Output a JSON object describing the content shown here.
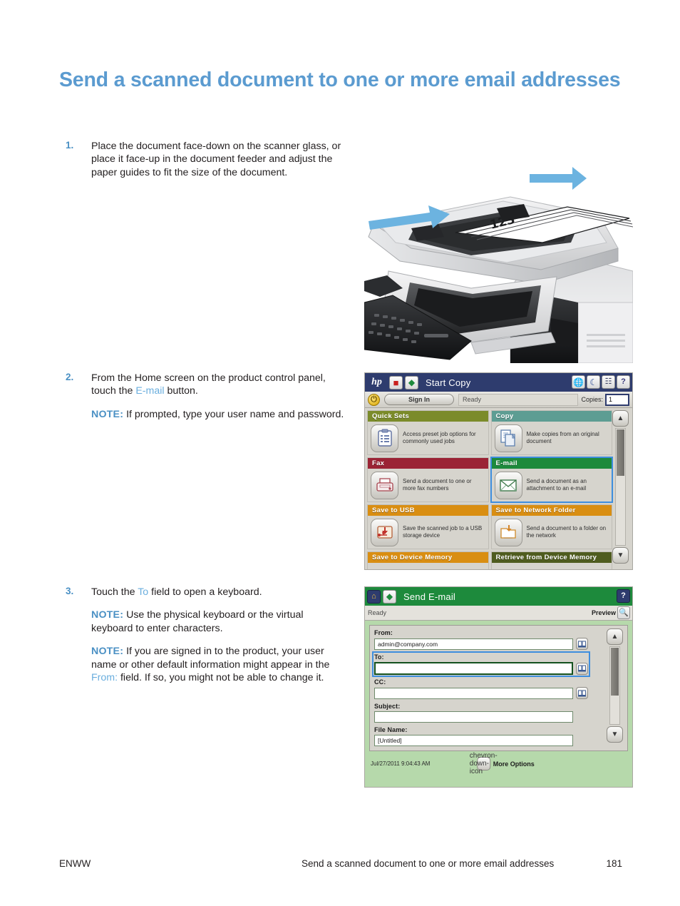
{
  "page": {
    "title": "Send a scanned document to one or more email addresses",
    "footer": {
      "locale": "ENWW",
      "running_title": "Send a scanned document to one or more email addresses",
      "page_number": "181"
    }
  },
  "steps": [
    {
      "number": "1.",
      "text_before": "Place the document face-down on the scanner glass, or place it face-up in the document feeder and adjust the paper guides to fit the size of the document.",
      "notes": []
    },
    {
      "number": "2.",
      "text_before": "From the Home screen on the product control panel, touch the ",
      "accent": "E-mail",
      "text_after": " button.",
      "notes": [
        {
          "label": "NOTE:",
          "text": "If prompted, type your user name and password."
        }
      ]
    },
    {
      "number": "3.",
      "text_before": "Touch the ",
      "accent": "To",
      "text_after": " field to open a keyboard.",
      "notes": [
        {
          "label": "NOTE:",
          "text": "Use the physical keyboard or the virtual keyboard to enter characters."
        },
        {
          "label": "NOTE:",
          "text_1": "If you are signed in to the product, your user name or other default information might appear in the ",
          "accent": "From:",
          "text_2": " field. If so, you might not be able to change it."
        }
      ]
    }
  ],
  "figure_printer": {
    "name": "multifunction-printer-document-feeder-illustration",
    "page_marking": "123",
    "arrow_color": "#6cb3e0"
  },
  "home_screen": {
    "brand": "hp",
    "title": "Start Copy",
    "title_bar_color": "#2e3c6e",
    "top_left_buttons": [
      {
        "name": "stop-button",
        "glyph": "☒",
        "color": "#c9211e"
      },
      {
        "name": "start-copy-button",
        "glyph": "◈",
        "color": "#1d8a3c"
      }
    ],
    "top_right_icons": [
      {
        "name": "language-globe-icon",
        "glyph": "●",
        "color": "#2b7d3e"
      },
      {
        "name": "sleep-moon-icon",
        "glyph": "☽",
        "color": "#1b3f8f"
      },
      {
        "name": "network-icon",
        "glyph": "⚉",
        "color": "#4a4a6a"
      },
      {
        "name": "help-icon",
        "glyph": "?",
        "color": "#3a3a7a"
      }
    ],
    "power_button": "⏻",
    "sign_in_label": "Sign In",
    "status": "Ready",
    "copies_label": "Copies:",
    "copies_value": "1",
    "tiles": [
      {
        "title": "Quick Sets",
        "color": "#7b8b2a",
        "description": "Access preset job options for commonly used jobs",
        "icon": "clipboard-list-icon",
        "selected": false
      },
      {
        "title": "Copy",
        "color": "#5d9d93",
        "description": "Make copies from an original document",
        "icon": "copy-pages-icon",
        "selected": false
      },
      {
        "title": "Fax",
        "color": "#9b2335",
        "description": "Send a document to one or more fax numbers",
        "icon": "fax-machine-icon",
        "selected": false
      },
      {
        "title": "E-mail",
        "color": "#1d8a3c",
        "description": "Send a document as an attachment to an e-mail",
        "icon": "envelope-icon",
        "selected": true
      },
      {
        "title": "Save to USB",
        "color": "#d98e12",
        "description": "Save the scanned job to a USB storage device",
        "icon": "usb-save-icon",
        "selected": false
      },
      {
        "title": "Save to Network Folder",
        "color": "#d98e12",
        "description": "Send a document to a folder on the network",
        "icon": "network-folder-icon",
        "selected": false
      },
      {
        "title": "Save to Device Memory",
        "color": "#d98e12",
        "description": "",
        "icon": "device-memory-icon",
        "selected": false
      },
      {
        "title": "Retrieve from Device Memory",
        "color": "#4f5c1f",
        "description": "",
        "icon": "retrieve-memory-icon",
        "selected": false
      }
    ],
    "scroll_up": "▲",
    "scroll_down": "▼"
  },
  "email_screen": {
    "title": "Send E-mail",
    "title_bar_color": "#1d8a3c",
    "home_icon": "home-icon",
    "start_icon": "start-send-icon",
    "help_icon": "help-icon",
    "status": "Ready",
    "preview_label": "Preview",
    "preview_icon": "magnifier-icon",
    "fields": [
      {
        "label": "From:",
        "value": "admin@company.com",
        "focused": false,
        "addressbook_icon": "address-book-icon"
      },
      {
        "label": "To:",
        "value": "",
        "focused": true,
        "addressbook_icon": "address-book-icon"
      },
      {
        "label": "CC:",
        "value": "",
        "focused": false,
        "addressbook_icon": "address-book-icon"
      },
      {
        "label": "Subject:",
        "value": "",
        "focused": false,
        "addressbook_icon": ""
      },
      {
        "label": "File Name:",
        "value": "[Untitled]",
        "focused": false,
        "addressbook_icon": ""
      }
    ],
    "timestamp": "Jul/27/2011 9:04:43 AM",
    "more_options_label": "More Options",
    "more_options_icon": "chevron-down-icon",
    "scroll_up": "▲",
    "scroll_down": "▼",
    "panel_bg": "#b6d9ab"
  }
}
